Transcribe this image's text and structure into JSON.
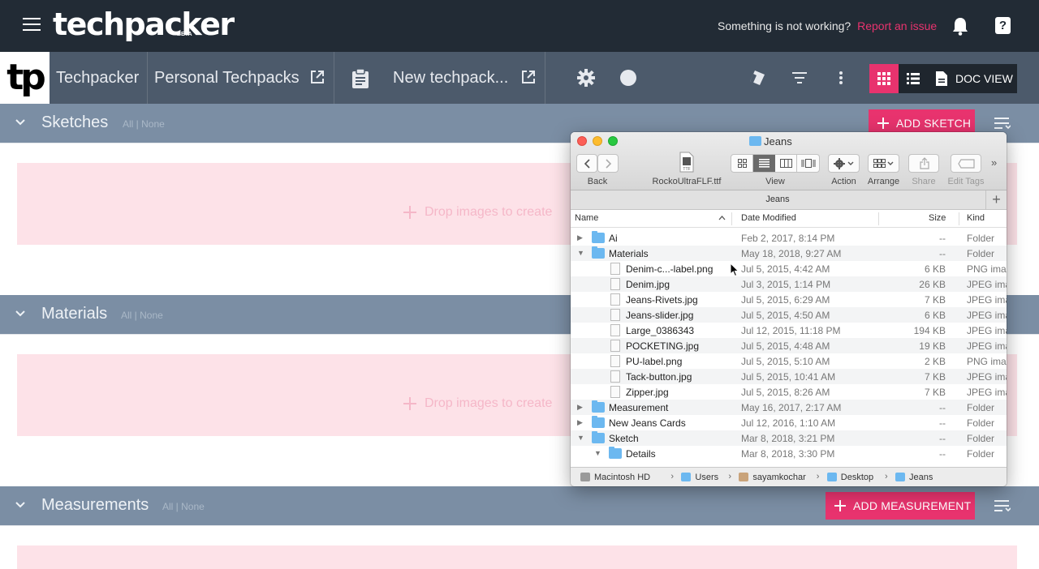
{
  "topbar": {
    "logo": "techpacker",
    "logo_badge": "BETA",
    "help_text": "Something is not working?",
    "report_link": "Report an issue"
  },
  "subnav": {
    "brand_mark": "tp",
    "brand": "Techpacker",
    "folder": "Personal Techpacks",
    "techpack": "New techpack...",
    "doc_view": "DOC VIEW"
  },
  "sections": [
    {
      "title": "Sketches",
      "all": "All",
      "none": "None",
      "drop_text": "Drop images to create",
      "button": "ADD SKETCH"
    },
    {
      "title": "Materials",
      "all": "All",
      "none": "None",
      "drop_text": "Drop images to create"
    },
    {
      "title": "Measurements",
      "all": "All",
      "none": "None",
      "button": "ADD MEASUREMENT"
    }
  ],
  "finder": {
    "title": "Jeans",
    "toolbar": {
      "back": "Back",
      "file": "RockoUltraFLF.ttf",
      "view": "View",
      "action": "Action",
      "arrange": "Arrange",
      "share": "Share",
      "edit_tags": "Edit Tags"
    },
    "path_tab": "Jeans",
    "columns": {
      "name": "Name",
      "date": "Date Modified",
      "size": "Size",
      "kind": "Kind"
    },
    "rows": [
      {
        "name": "Ai",
        "date": "Feb 2, 2017, 8:14 PM",
        "size": "--",
        "kind": "Folder",
        "type": "folder",
        "level": 0,
        "expanded": false
      },
      {
        "name": "Materials",
        "date": "May 18, 2018, 9:27 AM",
        "size": "--",
        "kind": "Folder",
        "type": "folder",
        "level": 0,
        "expanded": true
      },
      {
        "name": "Denim-c...-label.png",
        "date": "Jul 5, 2015, 4:42 AM",
        "size": "6 KB",
        "kind": "PNG ima",
        "type": "image",
        "level": 1
      },
      {
        "name": "Denim.jpg",
        "date": "Jul 3, 2015, 1:14 PM",
        "size": "26 KB",
        "kind": "JPEG ima",
        "type": "image",
        "level": 1
      },
      {
        "name": "Jeans-Rivets.jpg",
        "date": "Jul 5, 2015, 6:29 AM",
        "size": "7 KB",
        "kind": "JPEG ima",
        "type": "image",
        "level": 1
      },
      {
        "name": "Jeans-slider.jpg",
        "date": "Jul 5, 2015, 4:50 AM",
        "size": "6 KB",
        "kind": "JPEG ima",
        "type": "image",
        "level": 1
      },
      {
        "name": "Large_0386343",
        "date": "Jul 12, 2015, 11:18 PM",
        "size": "194 KB",
        "kind": "JPEG ima",
        "type": "image",
        "level": 1
      },
      {
        "name": "POCKETING.jpg",
        "date": "Jul 5, 2015, 4:48 AM",
        "size": "19 KB",
        "kind": "JPEG ima",
        "type": "image",
        "level": 1
      },
      {
        "name": "PU-label.png",
        "date": "Jul 5, 2015, 5:10 AM",
        "size": "2 KB",
        "kind": "PNG ima",
        "type": "image",
        "level": 1
      },
      {
        "name": "Tack-button.jpg",
        "date": "Jul 5, 2015, 10:41 AM",
        "size": "7 KB",
        "kind": "JPEG ima",
        "type": "image",
        "level": 1
      },
      {
        "name": "Zipper.jpg",
        "date": "Jul 5, 2015, 8:26 AM",
        "size": "7 KB",
        "kind": "JPEG ima",
        "type": "image",
        "level": 1
      },
      {
        "name": "Measurement",
        "date": "May 16, 2017, 2:17 AM",
        "size": "--",
        "kind": "Folder",
        "type": "folder",
        "level": 0,
        "expanded": false
      },
      {
        "name": "New Jeans Cards",
        "date": "Jul 12, 2016, 1:10 AM",
        "size": "--",
        "kind": "Folder",
        "type": "folder",
        "level": 0,
        "expanded": false
      },
      {
        "name": "Sketch",
        "date": "Mar 8, 2018, 3:21 PM",
        "size": "--",
        "kind": "Folder",
        "type": "folder",
        "level": 0,
        "expanded": true
      },
      {
        "name": "Details",
        "date": "Mar 8, 2018, 3:30 PM",
        "size": "--",
        "kind": "Folder",
        "type": "folder",
        "level": 1,
        "expanded": true
      }
    ],
    "breadcrumb": [
      "Macintosh HD",
      "Users",
      "sayamkochar",
      "Desktop",
      "Jeans"
    ]
  },
  "colors": {
    "accent": "#e8336e",
    "topbar": "#222b35",
    "subnav": "#4c5a6b",
    "section_header": "#7b8ea4",
    "drop_zone": "#fde2e8",
    "folder": "#6cb8f0"
  }
}
